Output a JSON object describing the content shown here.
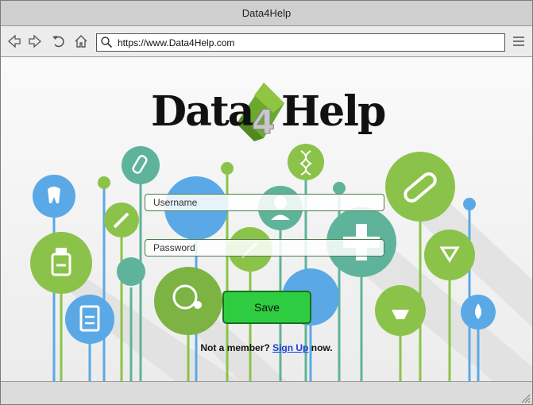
{
  "window": {
    "title": "Data4Help"
  },
  "browser": {
    "url": "https://www.Data4Help.com",
    "back_icon": "arrow-left-icon",
    "forward_icon": "arrow-right-icon",
    "reload_icon": "reload-icon",
    "home_icon": "home-icon",
    "search_icon": "search-icon",
    "menu_icon": "hamburger-menu-icon"
  },
  "logo": {
    "text_left": "Data",
    "text_mid": "4",
    "text_right": "Help"
  },
  "form": {
    "username_placeholder": "Username",
    "password_placeholder": "Password",
    "save_label": "Save",
    "signup_prefix": "Not a member?",
    "signup_link": "Sign Up",
    "signup_suffix": "now."
  },
  "colors": {
    "save": "#2ecc40",
    "link": "#1a3fd6",
    "green": "#8bc34a",
    "blue": "#5aa9e6",
    "teal": "#5fb39a"
  }
}
